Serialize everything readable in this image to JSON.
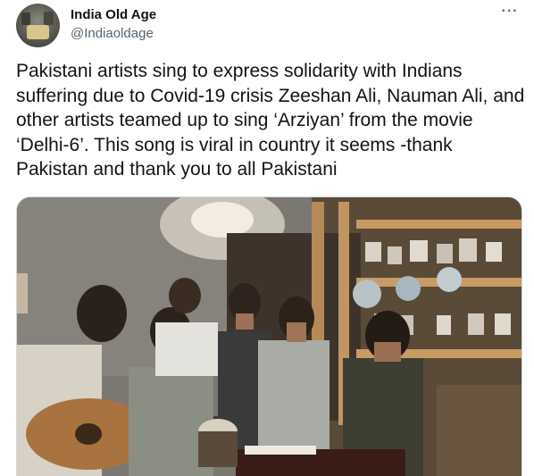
{
  "account": {
    "display_name": "India Old Age",
    "handle": "@Indiaoldage",
    "avatar_icon": "profile-avatar-image"
  },
  "tweet": {
    "text": "Pakistani artists sing to express solidarity with Indians suffering due to Covid-19 crisis Zeeshan Ali, Nauman Ali, and other artists teamed up to sing ‘Arziyan’ from the movie ‘Delhi-6’. This song is viral in country it seems -thank Pakistan and thank you to all Pakistani",
    "more_icon": "more-options-icon",
    "more_label": "···"
  },
  "media": {
    "kind": "video-still",
    "subject": "group-singing-room"
  },
  "colors": {
    "text_primary": "#0f1419",
    "text_secondary": "#536471",
    "border": "#cfd9de"
  }
}
